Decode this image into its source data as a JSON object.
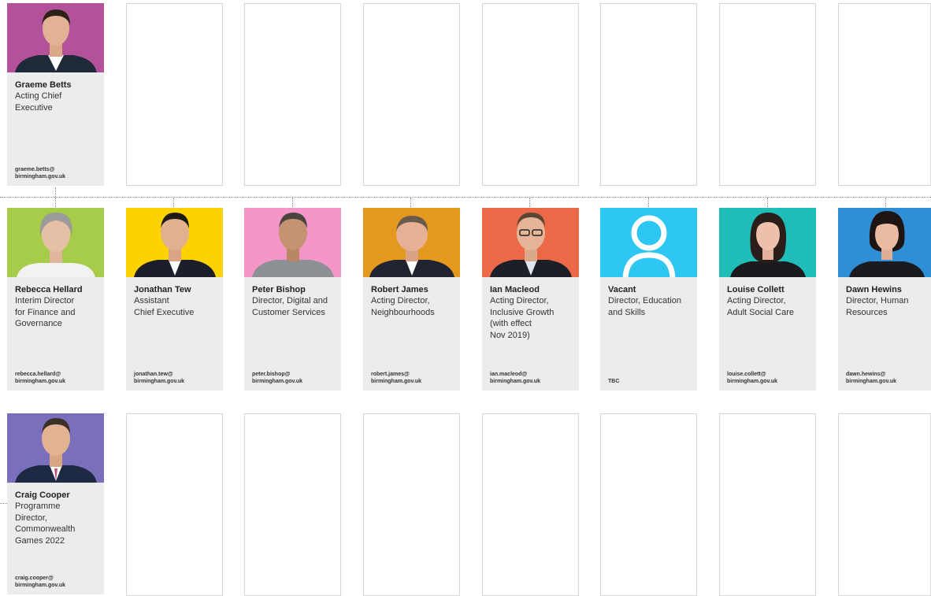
{
  "colors": {
    "graeme": "#b4519b",
    "rebecca": "#a6cc4a",
    "jonathan": "#fcd200",
    "peter": "#f596c8",
    "robert": "#e5981f",
    "ian": "#ec6947",
    "vacant": "#2ec6f2",
    "louise": "#1fbcb8",
    "dawn": "#2f8fd6",
    "craig": "#7a6fba"
  },
  "row1": [
    {
      "name": "Graeme Betts",
      "role": "Acting Chief\nExecutive",
      "email": "graeme.betts@\nbirmingham.gov.uk"
    }
  ],
  "row2": [
    {
      "name": "Rebecca Hellard",
      "role": "Interim Director\nfor Finance and\nGovernance",
      "email": "rebecca.hellard@\nbirmingham.gov.uk"
    },
    {
      "name": "Jonathan Tew",
      "role": "Assistant\nChief Executive",
      "email": "jonathan.tew@\nbirmingham.gov.uk"
    },
    {
      "name": "Peter Bishop",
      "role": "Director, Digital and\nCustomer Services",
      "email": "peter.bishop@\nbirmingham.gov.uk"
    },
    {
      "name": "Robert James",
      "role": "Acting Director,\nNeighbourhoods",
      "email": "robert.james@\nbirmingham.gov.uk"
    },
    {
      "name": "Ian Macleod",
      "role": "Acting Director,\nInclusive Growth\n(with effect\nNov 2019)",
      "email": "ian.macleod@\nbirmingham.gov.uk"
    },
    {
      "name": "Vacant",
      "role": "Director, Education\nand Skills",
      "email": "TBC"
    },
    {
      "name": "Louise Collett",
      "role": "Acting Director,\nAdult Social Care",
      "email": "louise.collett@\nbirmingham.gov.uk"
    },
    {
      "name": "Dawn Hewins",
      "role": "Director, Human\nResources",
      "email": "dawn.hewins@\nbirmingham.gov.uk"
    }
  ],
  "row3": [
    {
      "name": "Craig Cooper",
      "role": "Programme\nDirector,\nCommonwealth\nGames 2022",
      "email": "craig.cooper@\nbirmingham.gov.uk"
    }
  ]
}
